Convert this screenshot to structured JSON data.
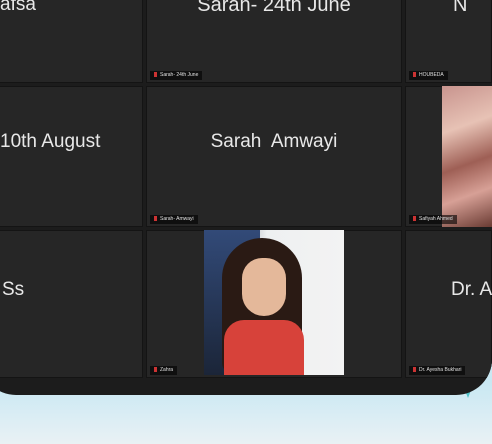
{
  "tiles": {
    "hafsa": {
      "name": "afsa"
    },
    "sarah_june": {
      "name": "Sarah- 24th June",
      "label": "Sarah- 24th June"
    },
    "right_top": {
      "name": "N",
      "label": "HOUBEDA"
    },
    "aug": {
      "name": "10th August"
    },
    "sarah_amwayi": {
      "name": "Sarah  Amwayi",
      "label": "Sarah- Amwayi"
    },
    "right_mid": {
      "label": "Safiyah Ahmed"
    },
    "ss": {
      "name": "Ss"
    },
    "video": {
      "label": "Zahra"
    },
    "dr": {
      "name": "Dr. A",
      "label": "Dr. Ayesha Bukhari"
    }
  },
  "colors": {
    "tile_bg": "#262626",
    "frame": "#1c1c1c",
    "accent": "#4fc2c8"
  }
}
